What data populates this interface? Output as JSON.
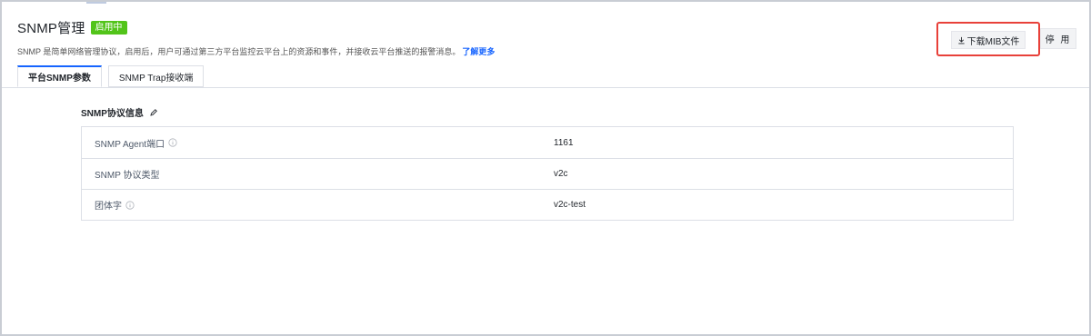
{
  "header": {
    "title": "SNMP管理",
    "status_badge": "启用中",
    "description": "SNMP 是简单网络管理协议，启用后，用户可通过第三方平台监控云平台上的资源和事件，并接收云平台推送的报警消息。",
    "learn_more": "了解更多"
  },
  "actions": {
    "download_mib": "下载MIB文件",
    "disable": "停 用"
  },
  "tabs": [
    {
      "label": "平台SNMP参数",
      "active": true
    },
    {
      "label": "SNMP Trap接收端",
      "active": false
    }
  ],
  "section": {
    "title": "SNMP协议信息"
  },
  "info_rows": [
    {
      "label": "SNMP Agent端口",
      "value": "1161",
      "has_info_icon": true
    },
    {
      "label": "SNMP 协议类型",
      "value": "v2c",
      "has_info_icon": false
    },
    {
      "label": "团体字",
      "value": "v2c-test",
      "has_info_icon": true
    }
  ],
  "colors": {
    "primary": "#1664ff",
    "success_badge": "#52c41a",
    "highlight_border": "#e8413a"
  },
  "icons": {
    "download": "download-icon",
    "edit": "pencil-icon",
    "info": "info-circle-icon"
  }
}
